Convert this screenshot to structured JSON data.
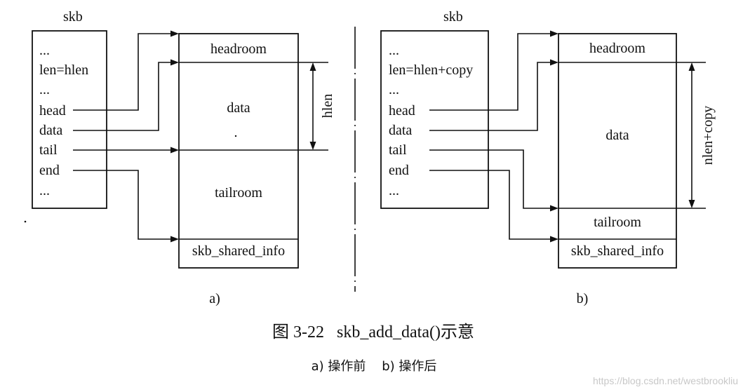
{
  "panel_a": {
    "struct_title": "skb",
    "fields": [
      "...",
      "len=hlen",
      "...",
      "head",
      "data",
      "tail",
      "end",
      "..."
    ],
    "regions": {
      "headroom": "headroom",
      "data": "data",
      "tailroom": "tailroom",
      "shared_info": "skb_shared_info"
    },
    "dim_label": "hlen",
    "label": "a)"
  },
  "panel_b": {
    "struct_title": "skb",
    "fields": [
      "...",
      "len=hlen+copy",
      "...",
      "head",
      "data",
      "tail",
      "end",
      "..."
    ],
    "regions": {
      "headroom": "headroom",
      "data": "data",
      "tailroom": "tailroom",
      "shared_info": "skb_shared_info"
    },
    "dim_label": "nlen+copy",
    "label": "b)"
  },
  "caption": "图 3-22   skb_add_data()示意",
  "subcaption": "a) 操作前    b) 操作后",
  "watermark": "https://blog.csdn.net/westbrookliu"
}
